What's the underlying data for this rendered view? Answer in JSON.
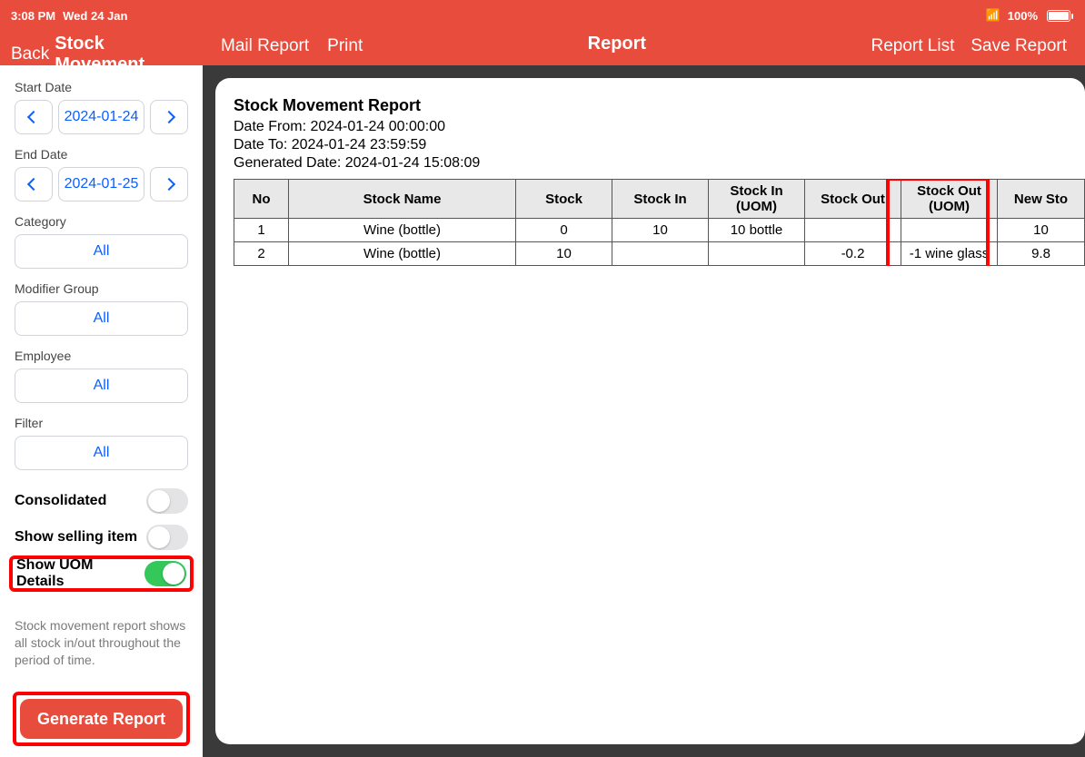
{
  "status": {
    "time": "3:08 PM",
    "date": "Wed 24 Jan",
    "batt": "100%"
  },
  "sidebar": {
    "back": "Back",
    "title": "Stock Movement",
    "start_label": "Start Date",
    "start_date": "2024-01-24",
    "end_label": "End Date",
    "end_date": "2024-01-25",
    "category_label": "Category",
    "category_val": "All",
    "modgroup_label": "Modifier Group",
    "modgroup_val": "All",
    "employee_label": "Employee",
    "employee_val": "All",
    "filter_label": "Filter",
    "filter_val": "All",
    "toggles": {
      "consolidated": "Consolidated",
      "selling": "Show selling item",
      "uom": "Show UOM Details"
    },
    "desc": "Stock movement report shows all stock in/out throughout the period of time.",
    "generate": "Generate Report"
  },
  "header": {
    "mail": "Mail Report",
    "print": "Print",
    "title": "Report",
    "list": "Report List",
    "save": "Save Report"
  },
  "report": {
    "title": "Stock Movement Report",
    "from": "Date From: 2024-01-24 00:00:00",
    "to": "Date To: 2024-01-24 23:59:59",
    "gen": "Generated Date: 2024-01-24 15:08:09",
    "cols": {
      "no": "No",
      "name": "Stock Name",
      "stock": "Stock",
      "in": "Stock In",
      "inuom": "Stock In (UOM)",
      "out": "Stock Out",
      "outuom": "Stock Out (UOM)",
      "new": "New Sto"
    },
    "rows": [
      {
        "no": "1",
        "name": "Wine (bottle)",
        "stock": "0",
        "in": "10",
        "inuom": "10 bottle",
        "out": "",
        "outuom": "",
        "new": "10"
      },
      {
        "no": "2",
        "name": "Wine (bottle)",
        "stock": "10",
        "in": "",
        "inuom": "",
        "out": "-0.2",
        "outuom": "-1 wine glass",
        "new": "9.8"
      }
    ]
  }
}
